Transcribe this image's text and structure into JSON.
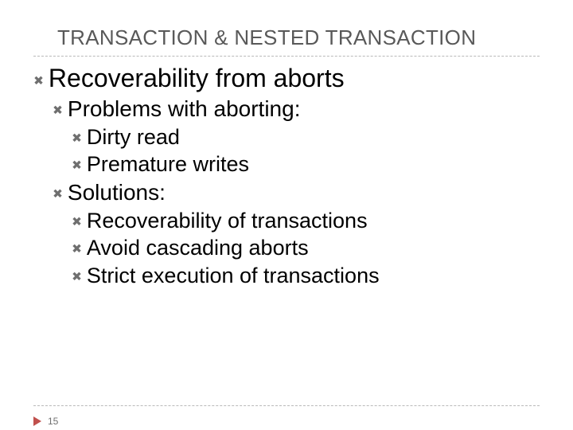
{
  "slide": {
    "title": "TRANSACTION & NESTED TRANSACTION",
    "page_number": "15",
    "bullet_glyph": "✖",
    "bullets": {
      "b0": "Recoverability from aborts",
      "b1": "Problems with aborting:",
      "b2": "Dirty read",
      "b3": "Premature writes",
      "b4": "Solutions:",
      "b5": "Recoverability of transactions",
      "b6": "Avoid cascading aborts",
      "b7": "Strict execution of transactions"
    }
  }
}
